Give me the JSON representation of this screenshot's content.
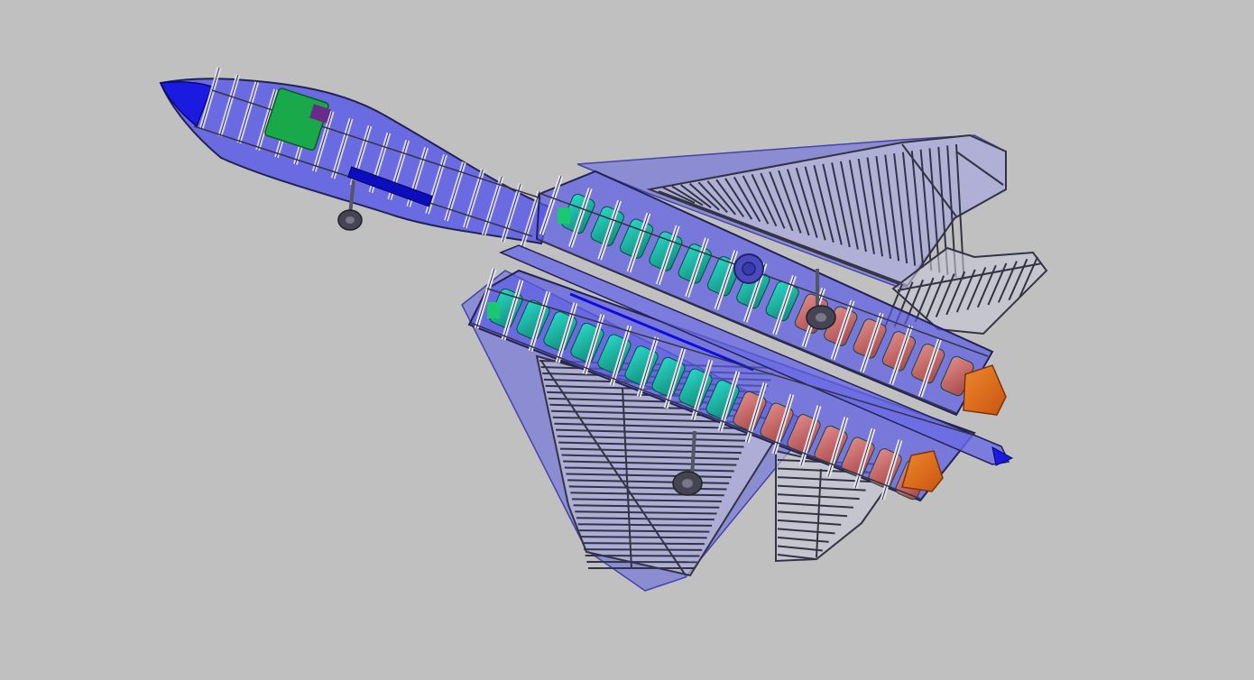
{
  "scene": {
    "subject": "cad-aircraft-structure-wireframe",
    "background_color": "#c0c0c0",
    "colors": {
      "skin": "#5a5ae6",
      "skin_dark": "#2b2bd0",
      "nose_tip": "#1a1ae0",
      "wing_skin": "#7b7bd8",
      "frame": "#d8d8e4",
      "frame_edge": "#333344",
      "tank_teal": "#1fb8a8",
      "tank_green": "#19a84a",
      "tank_red": "#c86a6a",
      "nozzle_orange": "#e86a1a",
      "gear_dark": "#444455"
    }
  }
}
